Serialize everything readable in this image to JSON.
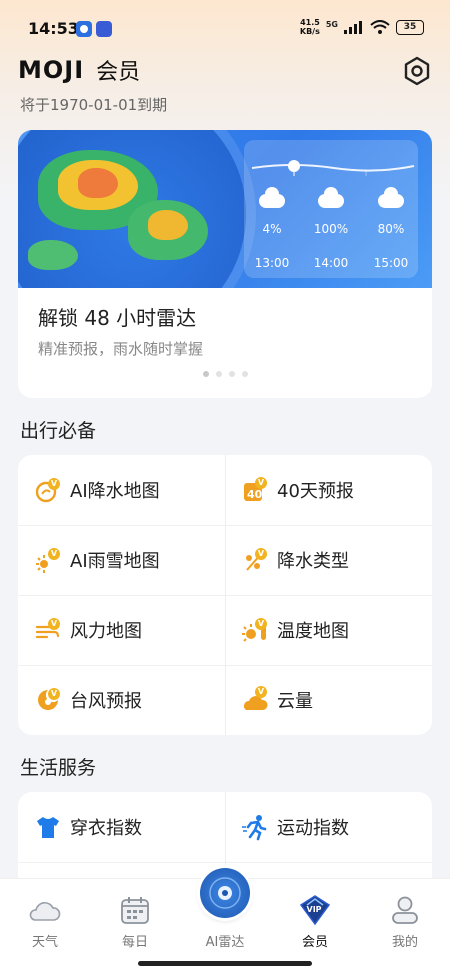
{
  "status_bar": {
    "time": "14:53",
    "net_speed_value": "41.5",
    "net_speed_unit": "KB/s",
    "network": "5G",
    "battery": "35"
  },
  "header": {
    "logo": "MOJI",
    "title": "会员",
    "expire_text": "将于1970-01-01到期"
  },
  "banner": {
    "title": "解锁 48 小时雷达",
    "subtitle": "精准预报，雨水随时掌握",
    "forecast": [
      {
        "pct": "4%",
        "time": "13:00"
      },
      {
        "pct": "100%",
        "time": "14:00"
      },
      {
        "pct": "80%",
        "time": "15:00"
      }
    ],
    "page_count": 4,
    "active_page": 0
  },
  "travel": {
    "title": "出行必备",
    "items": [
      {
        "label": "AI降水地图",
        "icon": "precip-map-icon"
      },
      {
        "label": "40天预报",
        "icon": "forecast-40-icon"
      },
      {
        "label": "AI雨雪地图",
        "icon": "rain-snow-map-icon"
      },
      {
        "label": "降水类型",
        "icon": "precip-type-icon"
      },
      {
        "label": "风力地图",
        "icon": "wind-map-icon"
      },
      {
        "label": "温度地图",
        "icon": "temperature-map-icon"
      },
      {
        "label": "台风预报",
        "icon": "typhoon-icon"
      },
      {
        "label": "云量",
        "icon": "cloud-cover-icon"
      }
    ]
  },
  "life": {
    "title": "生活服务",
    "items": [
      {
        "label": "穿衣指数",
        "icon": "clothing-icon"
      },
      {
        "label": "运动指数",
        "icon": "sport-icon"
      }
    ]
  },
  "nav": [
    {
      "label": "天气",
      "icon": "cloud-icon"
    },
    {
      "label": "每日",
      "icon": "calendar-icon"
    },
    {
      "label": "AI雷达",
      "icon": "radar-icon"
    },
    {
      "label": "会员",
      "icon": "vip-icon"
    },
    {
      "label": "我的",
      "icon": "user-icon"
    }
  ],
  "vip_badge": "VIP",
  "colors": {
    "accent_orange": "#f0a020",
    "radar_blue": "#2f78e8",
    "vip_badge_blue": "#1d3f8f",
    "shirt_blue": "#1f7be8"
  }
}
